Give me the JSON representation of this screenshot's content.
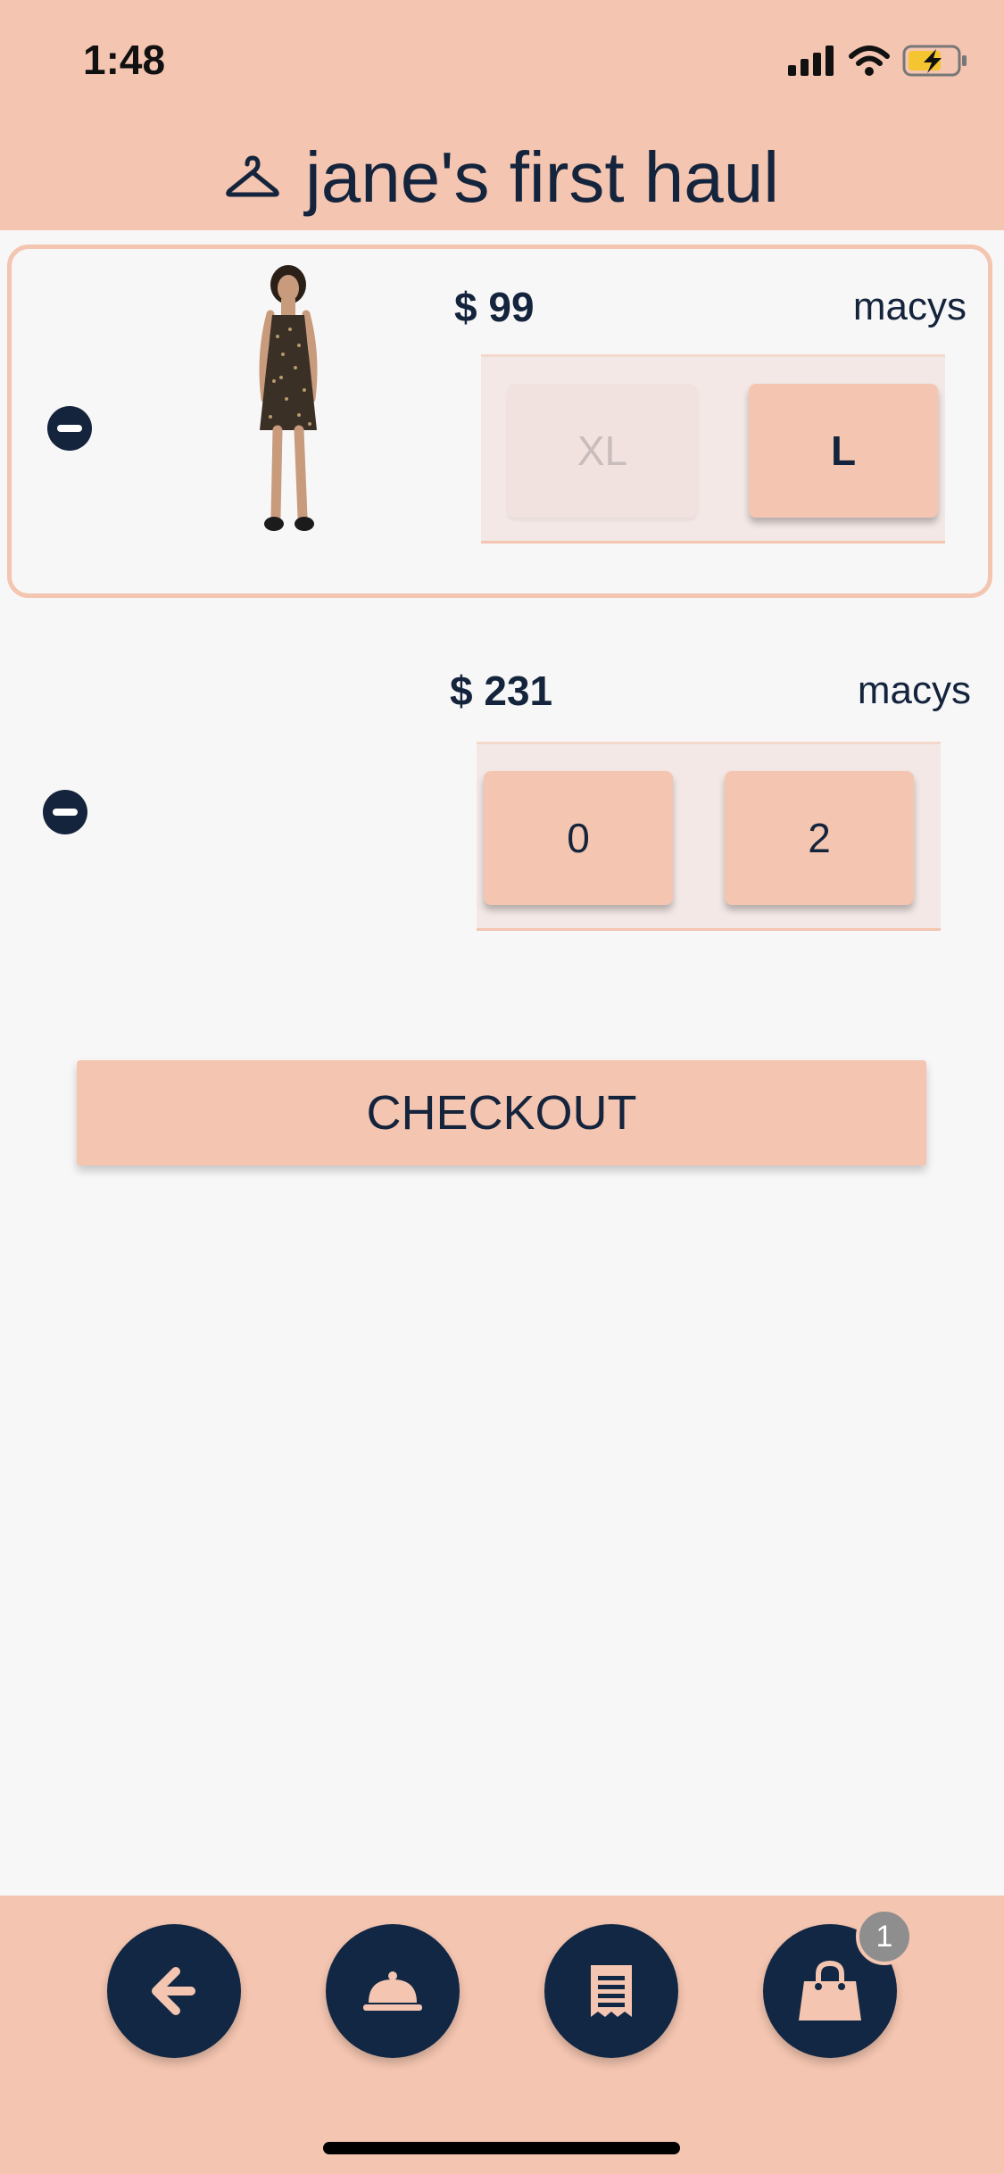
{
  "status_bar": {
    "time": "1:48"
  },
  "header": {
    "title": "jane's first haul",
    "icon": "hanger-icon"
  },
  "items": [
    {
      "price": "$ 99",
      "store": "macys",
      "sizes": [
        "XL",
        "L"
      ],
      "image": "dress-product-image"
    },
    {
      "price": "$ 231",
      "store": "macys",
      "sizes": [
        "0",
        "2"
      ]
    }
  ],
  "checkout": {
    "label": "CHECKOUT"
  },
  "bottom_nav": {
    "items": [
      "back-arrow-icon",
      "service-bell-icon",
      "receipt-icon",
      "shopping-bag-icon"
    ],
    "bag_badge": "1"
  },
  "colors": {
    "accent": "#f4c5b0",
    "navy": "#112744",
    "background": "#f8f7f7"
  }
}
